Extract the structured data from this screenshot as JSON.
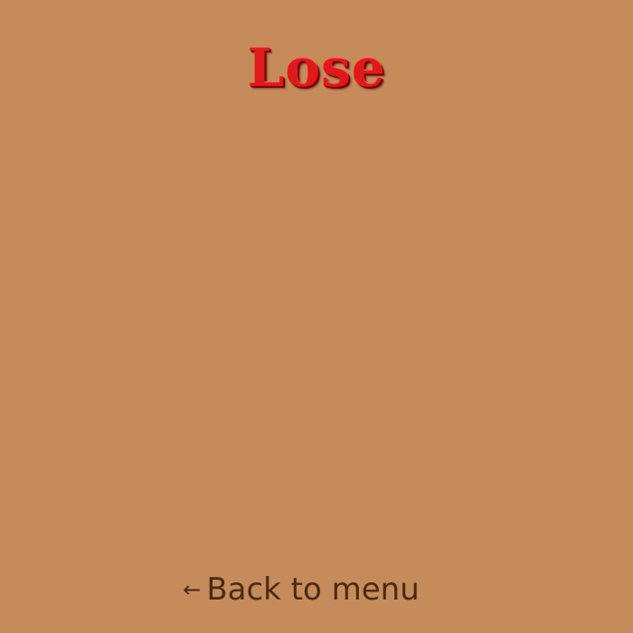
{
  "screen": {
    "title": "Lose",
    "background_color": "#c68b5b",
    "title_color": "#e01a1a"
  },
  "back": {
    "icon": "arrow-left-icon",
    "label": "Back to menu",
    "color": "#4b2a12"
  }
}
